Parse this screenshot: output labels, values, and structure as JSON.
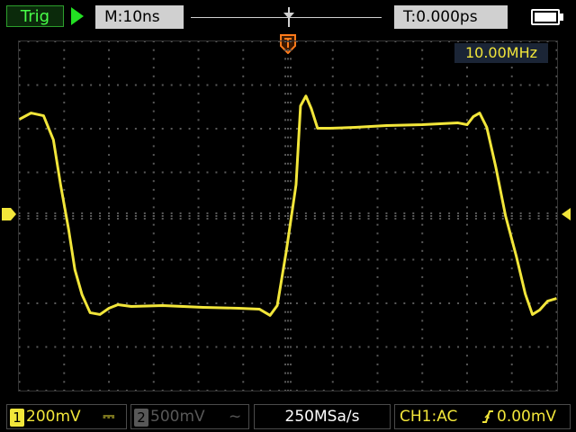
{
  "topbar": {
    "trigger_status": "Trig",
    "run_icon": "play-triangle",
    "timebase": "M:10ns",
    "trigger_time": "T:0.000ps",
    "battery_icon": "battery-full"
  },
  "display": {
    "frequency": "10.00MHz",
    "trigger_position_icon": "T-marker",
    "colors": {
      "trace": "#f2e63a",
      "grid": "#5a5a5a",
      "background": "#000000"
    }
  },
  "bottombar": {
    "ch1": {
      "number": "1",
      "scale": "200mV",
      "coupling": "⎓"
    },
    "ch2": {
      "number": "2",
      "scale": "500mV",
      "coupling": "~"
    },
    "sample_rate": "250MSa/s",
    "trigger": {
      "source": "CH1:AC",
      "level": "0.00mV"
    }
  }
}
